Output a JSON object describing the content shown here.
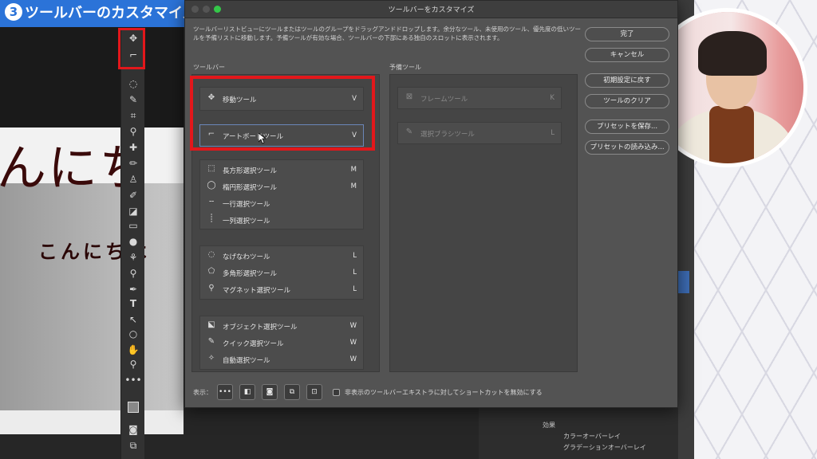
{
  "video": {
    "title_number": "3",
    "title_text": "ツールバーのカスタマイズ"
  },
  "canvas": {
    "big_text": "んにち",
    "small_text": "こんにちは"
  },
  "dialog": {
    "title": "ツールバーをカスタマイズ",
    "description": "ツールバーリストビューにツールまたはツールのグループをドラッグアンドドロップします。余分なツール、未使用のツール、優先度の低いツールを予備リストに移動します。予備ツールが有効な場合、ツールバーの下部にある独自のスロットに表示されます。",
    "toolbar_label": "ツールバー",
    "reserve_label": "予備ツール",
    "toolbar_groups": [
      {
        "tools": [
          {
            "icon": "move-icon",
            "label": "移動ツール",
            "key": "V"
          },
          {
            "icon": "artboard-icon",
            "label": "アートボードツール",
            "key": "V"
          }
        ]
      },
      {
        "tools": [
          {
            "icon": "rect-marquee-icon",
            "label": "長方形選択ツール",
            "key": "M"
          },
          {
            "icon": "ellipse-marquee-icon",
            "label": "楕円形選択ツール",
            "key": "M"
          },
          {
            "icon": "row-marquee-icon",
            "label": "一行選択ツール",
            "key": ""
          },
          {
            "icon": "column-marquee-icon",
            "label": "一列選択ツール",
            "key": ""
          }
        ]
      },
      {
        "tools": [
          {
            "icon": "lasso-icon",
            "label": "なげなわツール",
            "key": "L"
          },
          {
            "icon": "polygon-lasso-icon",
            "label": "多角形選択ツール",
            "key": "L"
          },
          {
            "icon": "magnetic-lasso-icon",
            "label": "マグネット選択ツール",
            "key": "L"
          }
        ]
      },
      {
        "tools": [
          {
            "icon": "object-select-icon",
            "label": "オブジェクト選択ツール",
            "key": "W"
          },
          {
            "icon": "quick-select-icon",
            "label": "クイック選択ツール",
            "key": "W"
          },
          {
            "icon": "magic-wand-icon",
            "label": "自動選択ツール",
            "key": "W"
          }
        ]
      }
    ],
    "reserve_tools": [
      {
        "icon": "frame-icon",
        "label": "フレームツール",
        "key": "K"
      },
      {
        "icon": "select-brush-icon",
        "label": "選択ブラシツール",
        "key": "L"
      }
    ],
    "buttons": {
      "done": "完了",
      "cancel": "キャンセル",
      "restore": "初期設定に戻す",
      "clear": "ツールのクリア",
      "save_preset": "プリセットを保存...",
      "load_preset": "プリセットの読み込み..."
    },
    "display_label": "表示：",
    "shortcut_label": "非表示のツールバーエキストラに対してショートカットを無効にする"
  },
  "layers": {
    "effects": "効果",
    "color_overlay": "カラーオーバーレイ",
    "gradient_overlay": "グラデーションオーバーレイ"
  }
}
